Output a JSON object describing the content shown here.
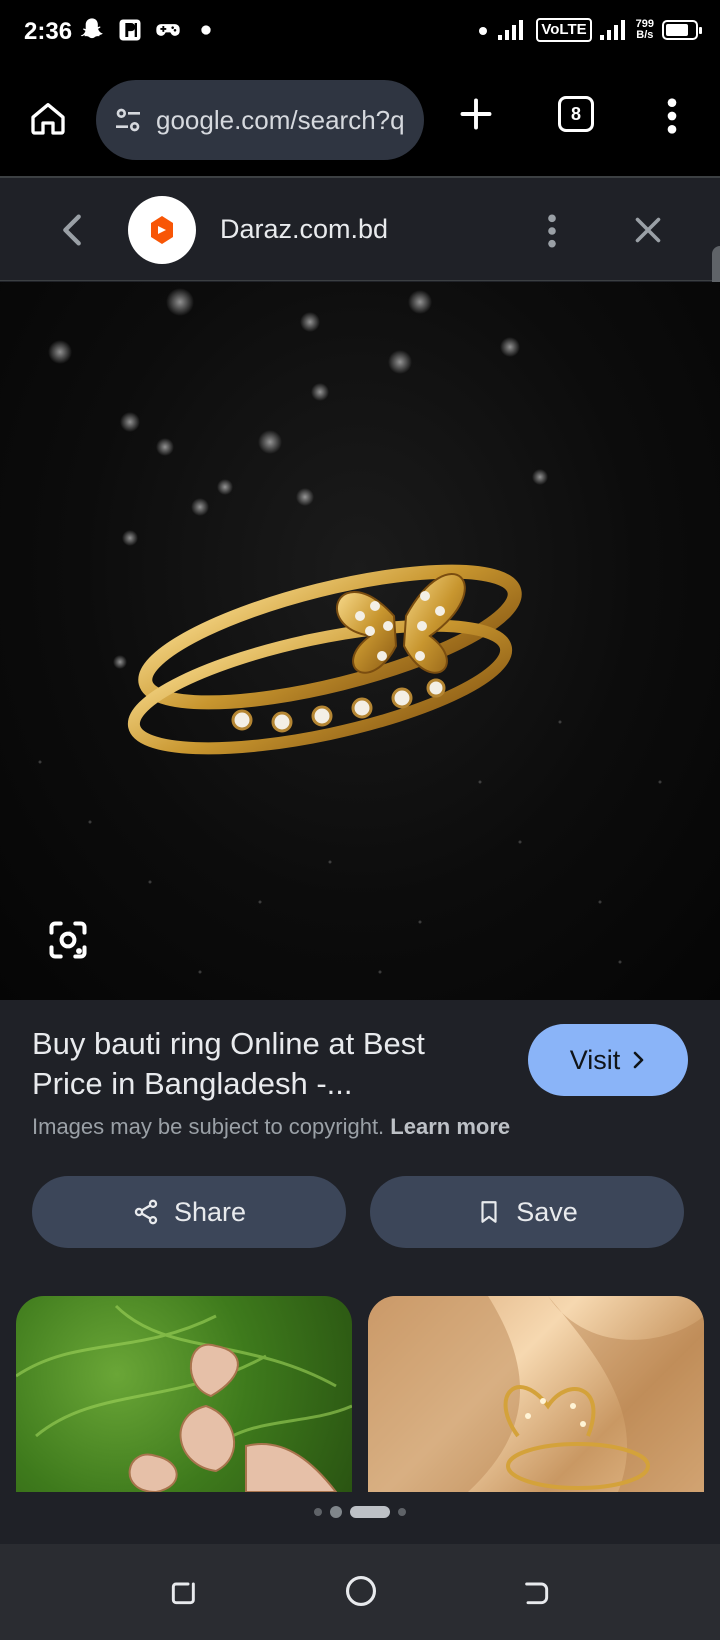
{
  "status_bar": {
    "time": "2:36",
    "volte": "VoLTE",
    "speed_value": "799",
    "speed_unit": "B/s",
    "battery_level": 0.8,
    "icons": [
      "snapchat-icon",
      "parking-icon",
      "gamepad-icon",
      "dot-icon",
      "signal-icon",
      "battery-icon"
    ]
  },
  "toolbar": {
    "url": "google.com/search?q",
    "tab_count": "8"
  },
  "panel": {
    "site_name": "Daraz.com.bd",
    "brand_color": "#f85606",
    "result_title": "Buy bauti ring Online at Best Price in Bangladesh -...",
    "visit_label": "Visit",
    "copyright_text": "Images may be subject to copyright.",
    "learn_more": "Learn more",
    "share_label": "Share",
    "save_label": "Save"
  },
  "colors": {
    "accent": "#8ab4f8",
    "panel_bg": "#1f2127",
    "button_bg": "#3c4659"
  }
}
